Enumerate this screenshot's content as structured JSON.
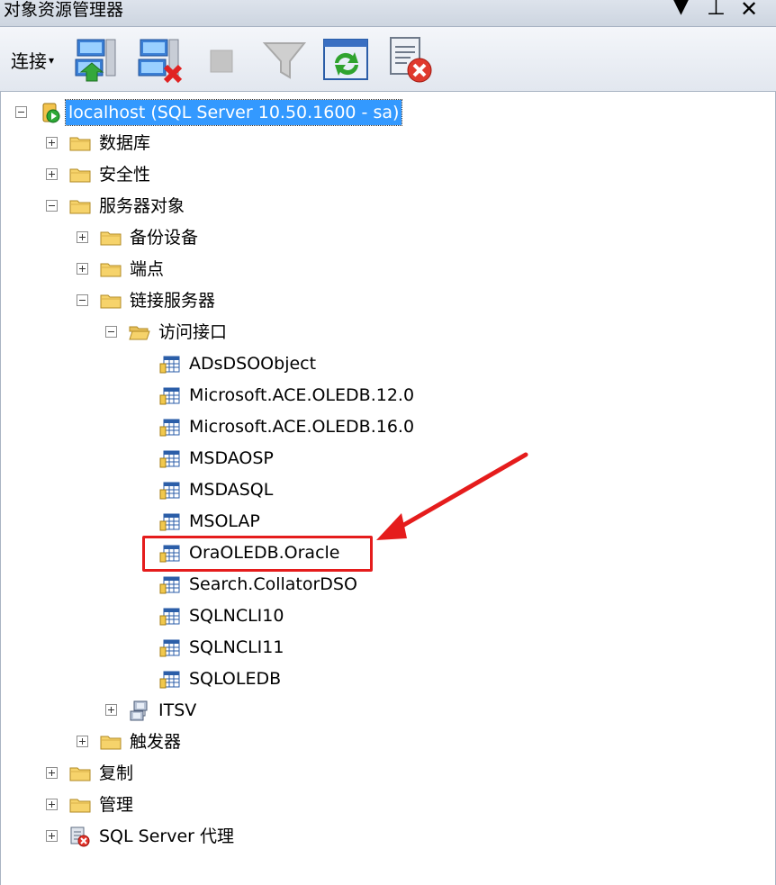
{
  "window": {
    "title": "对象资源管理器",
    "dropdown_glyph": "▼",
    "pin_glyph": "⊥",
    "close_glyph": "✕"
  },
  "toolbar": {
    "connect_label": "连接",
    "connect_caret": "▾",
    "icons": [
      "connect-server-icon",
      "disconnect-server-icon",
      "stop-icon",
      "filter-icon",
      "refresh-icon",
      "properties-report-icon"
    ]
  },
  "tree": {
    "root": {
      "label": "localhost (SQL Server 10.50.1600 - sa)",
      "expanded": true,
      "selected": true
    },
    "databases": {
      "label": "数据库",
      "expanded": false
    },
    "security": {
      "label": "安全性",
      "expanded": false
    },
    "server_objects": {
      "label": "服务器对象",
      "expanded": true
    },
    "backup_devices": {
      "label": "备份设备",
      "expanded": false
    },
    "endpoints": {
      "label": "端点",
      "expanded": false
    },
    "linked_servers": {
      "label": "链接服务器",
      "expanded": true
    },
    "providers": {
      "label": "访问接口",
      "expanded": true
    },
    "provider_items": [
      "ADsDSOObject",
      "Microsoft.ACE.OLEDB.12.0",
      "Microsoft.ACE.OLEDB.16.0",
      "MSDAOSP",
      "MSDASQL",
      "MSOLAP",
      "OraOLEDB.Oracle",
      "Search.CollatorDSO",
      "SQLNCLI10",
      "SQLNCLI11",
      "SQLOLEDB"
    ],
    "itsv": {
      "label": "ITSV",
      "expanded": false
    },
    "triggers": {
      "label": "触发器",
      "expanded": false
    },
    "replication": {
      "label": "复制",
      "expanded": false
    },
    "management": {
      "label": "管理",
      "expanded": false
    },
    "agent": {
      "label": "SQL Server 代理",
      "expanded": false
    }
  },
  "annotation": {
    "highlighted_item": "OraOLEDB.Oracle",
    "color": "#e51c1c"
  }
}
